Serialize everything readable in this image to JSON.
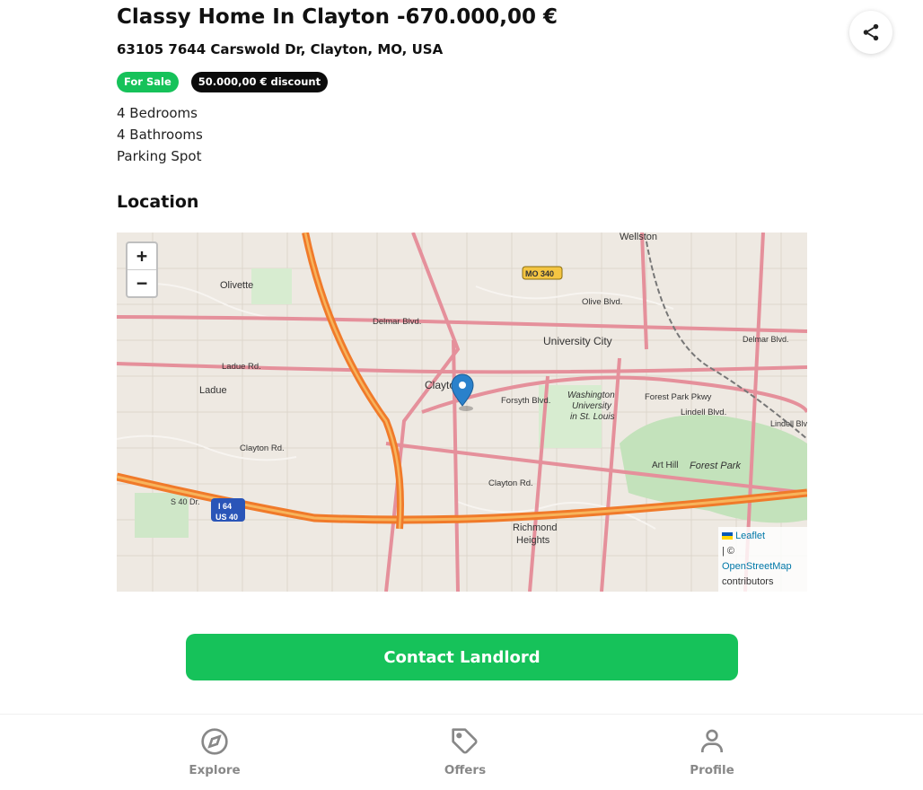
{
  "listing": {
    "title": "Classy Home In Clayton -670.000,00 €",
    "address": "63105 7644 Carswold Dr, Clayton, MO, USA",
    "badges": {
      "status": "For Sale",
      "discount": "50.000,00 € discount"
    },
    "features": [
      "4 Bedrooms",
      "4 Bathrooms",
      "Parking Spot"
    ]
  },
  "location": {
    "section_title": "Location",
    "map": {
      "zoom_in": "+",
      "zoom_out": "−",
      "attribution": {
        "leaflet": "Leaflet",
        "separator": "| ©",
        "osm": "OpenStreetMap",
        "suffix": "contributors"
      },
      "labels": {
        "wellston": "Wellston",
        "olivette": "Olivette",
        "mo340": "MO 340",
        "olive_blvd": "Olive Blvd.",
        "delmar_blvd": "Delmar Blvd.",
        "university_city": "University City",
        "ladue_rd": "Ladue Rd.",
        "ladue": "Ladue",
        "clayton": "Clayton",
        "forsyth_blvd": "Forsyth Blvd.",
        "washington_univ": "Washington",
        "univ2": "University",
        "univ3": "in St. Louis",
        "forest_park_pkwy": "Forest Park Pkwy",
        "lindell_blvd": "Lindell Blvd.",
        "clayton_rd": "Clayton Rd.",
        "art_hill": "Art Hill",
        "forest_park": "Forest Park",
        "i64": "I 64",
        "us40": "US 40",
        "richmond": "Richmond",
        "heights": "Heights",
        "s40_dr": "S 40 Dr.",
        "delmar_east": "Delmar Blvd.",
        "lindell_east": "Lindell Blvd"
      }
    }
  },
  "actions": {
    "contact": "Contact Landlord"
  },
  "nav": [
    {
      "label": "Explore",
      "icon": "compass-icon"
    },
    {
      "label": "Offers",
      "icon": "tag-icon"
    },
    {
      "label": "Profile",
      "icon": "person-icon"
    }
  ],
  "colors": {
    "accent": "#16c25a",
    "highway": "#f07a2a",
    "major_road": "#e8909a",
    "park": "#b8dcb1"
  }
}
